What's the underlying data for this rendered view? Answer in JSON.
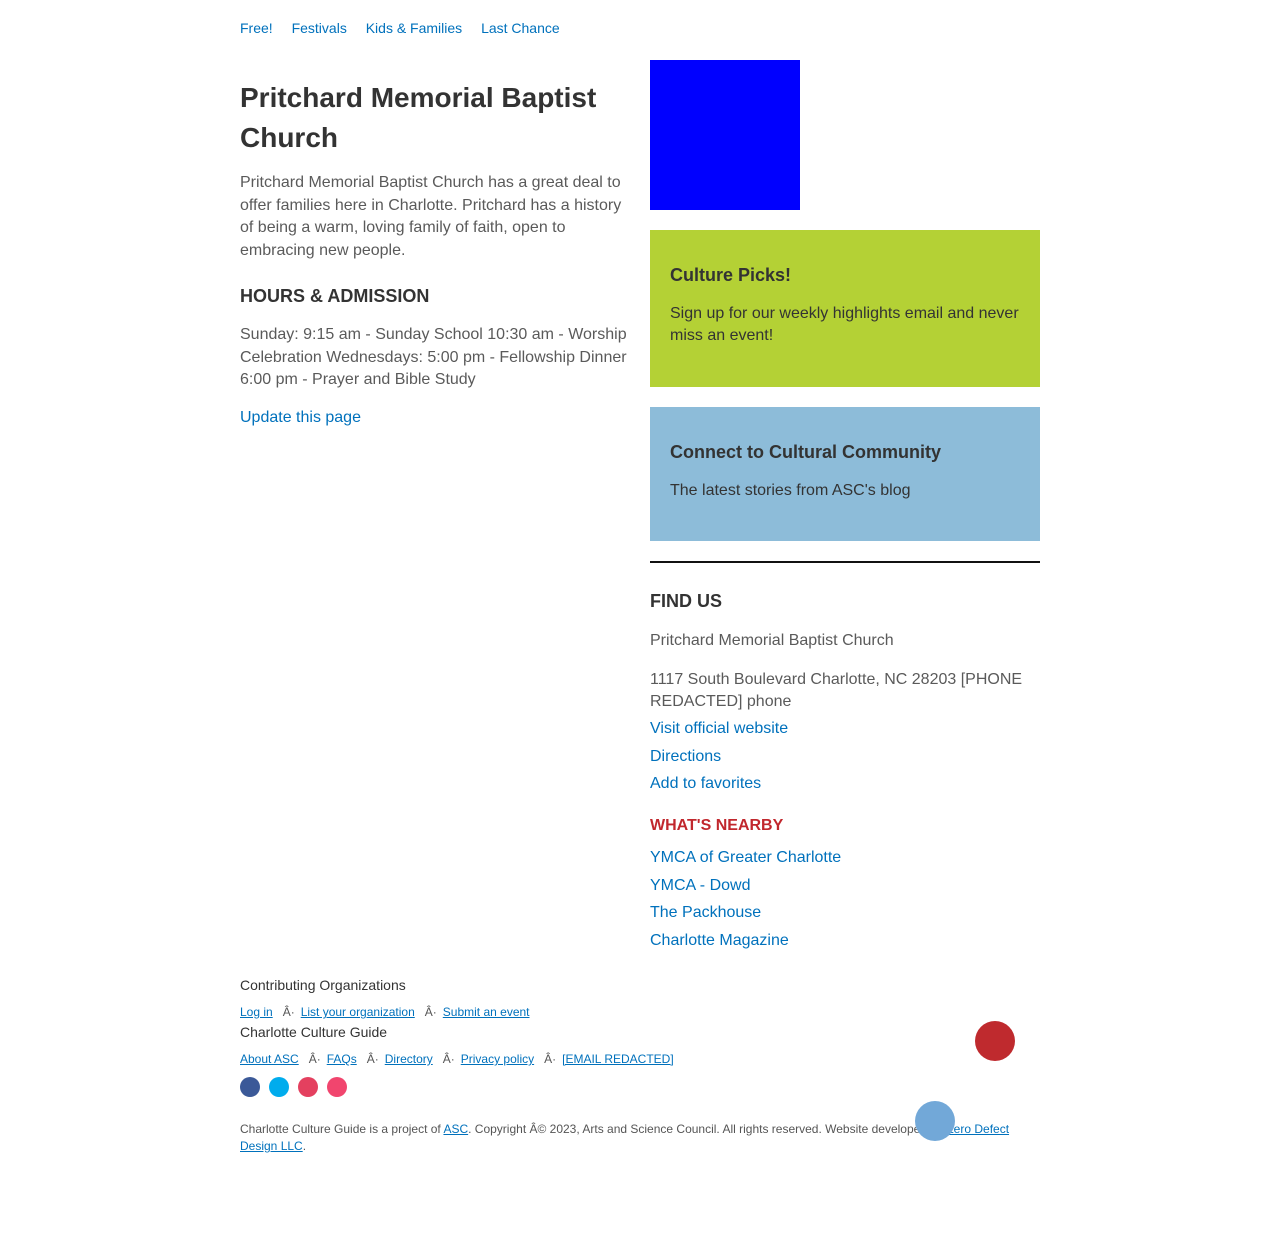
{
  "topnav": {
    "items": [
      {
        "label": "Free!"
      },
      {
        "label": "Festivals"
      },
      {
        "label": "Kids & Families"
      },
      {
        "label": "Last Chance"
      }
    ]
  },
  "main": {
    "title": "Pritchard Memorial Baptist Church",
    "intro": "Pritchard Memorial Baptist Church has a great deal to offer families here in Charlotte. Pritchard has a history of being a warm, loving family of faith, open to embracing new people.",
    "hours_heading": "HOURS & ADMISSION",
    "hours_text": "Sunday: 9:15 am - Sunday School 10:30 am - Worship Celebration Wednesdays: 5:00 pm - Fellowship Dinner 6:00 pm - Prayer and Bible Study",
    "update_link": "Update this page"
  },
  "sidebar": {
    "image_color": "#0000ff",
    "culture_picks": {
      "title": "Culture Picks!",
      "text": "Sign up for our weekly highlights email and never miss an event!",
      "bg": "#b4d135"
    },
    "connect": {
      "title": "Connect to Cultural Community",
      "text": "The latest stories from ASC's blog",
      "bg": "#8dbcd9"
    },
    "find_us": {
      "heading": "FIND US",
      "name": "Pritchard Memorial Baptist Church",
      "address": "1117 South Boulevard Charlotte, NC 28203 [PHONE REDACTED] phone",
      "links": {
        "website": "Visit official website",
        "directions": "Directions",
        "favorites": "Add to favorites"
      }
    },
    "nearby": {
      "heading": "WHAT'S NEARBY",
      "heading_color": "#c1272d",
      "items": [
        {
          "label": "YMCA of Greater Charlotte"
        },
        {
          "label": "YMCA - Dowd"
        },
        {
          "label": "The Packhouse"
        },
        {
          "label": "Charlotte Magazine"
        }
      ]
    }
  },
  "footer": {
    "orgs_title": "Contributing Organizations",
    "org_links": {
      "login": "Log in",
      "list": "List your organization",
      "submit": "Submit an event"
    },
    "guide_title": "Charlotte Culture Guide",
    "guide_links": {
      "about": "About ASC",
      "faqs": "FAQs",
      "directory": "Directory",
      "privacy": "Privacy policy",
      "email": "[EMAIL REDACTED]"
    },
    "separator": "Â·",
    "social": [
      {
        "icon": "facebook-icon",
        "color": "#3b5998"
      },
      {
        "icon": "twitter-icon",
        "color": "#00aced"
      },
      {
        "icon": "instagram-icon",
        "color": "#e4405f"
      },
      {
        "icon": "flickr-icon",
        "color": "#f1456e"
      }
    ],
    "copyright": {
      "prefix": "Charlotte Culture Guide is a project of ",
      "asc": "ASC",
      "middle": ". Copyright Â© 2023, Arts and Science Council. All rights reserved. Website developed by ",
      "developer": "Zero Defect Design LLC",
      "suffix": "."
    }
  },
  "floating": {
    "red_color": "#bf2a2e",
    "blue_color": "#72a8d8"
  }
}
